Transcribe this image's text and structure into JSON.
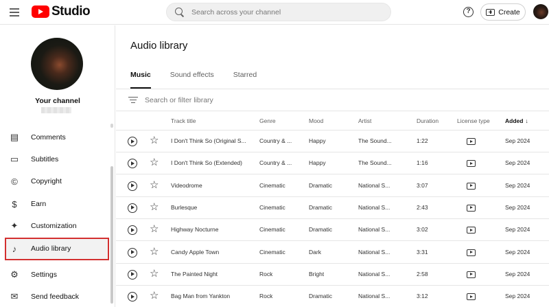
{
  "header": {
    "logo_text": "Studio",
    "search_placeholder": "Search across your channel",
    "help_symbol": "?",
    "create_label": "Create"
  },
  "sidebar": {
    "channel_title": "Your channel",
    "items": [
      {
        "label": "Comments",
        "icon": "comment-icon",
        "glyph": "▤"
      },
      {
        "label": "Subtitles",
        "icon": "subtitles-icon",
        "glyph": "▭"
      },
      {
        "label": "Copyright",
        "icon": "copyright-icon",
        "glyph": "©"
      },
      {
        "label": "Earn",
        "icon": "dollar-icon",
        "glyph": "$"
      },
      {
        "label": "Customization",
        "icon": "magic-wand-icon",
        "glyph": "✦"
      },
      {
        "label": "Audio library",
        "icon": "audio-library-icon",
        "glyph": "♪",
        "active": true
      },
      {
        "label": "Settings",
        "icon": "gear-icon",
        "glyph": "⚙"
      },
      {
        "label": "Send feedback",
        "icon": "feedback-icon",
        "glyph": "✉"
      }
    ]
  },
  "main": {
    "title": "Audio library",
    "tabs": [
      {
        "label": "Music",
        "active": true
      },
      {
        "label": "Sound effects"
      },
      {
        "label": "Starred"
      }
    ],
    "filter_placeholder": "Search or filter library",
    "columns": {
      "track_title": "Track title",
      "genre": "Genre",
      "mood": "Mood",
      "artist": "Artist",
      "duration": "Duration",
      "license_type": "License type",
      "added": "Added",
      "added_sort_arrow": "↓"
    },
    "rows": [
      {
        "title": "I Don't Think So (Original S...",
        "genre": "Country & ...",
        "mood": "Happy",
        "artist": "The Sound...",
        "duration": "1:22",
        "added": "Sep 2024"
      },
      {
        "title": "I Don't Think So (Extended)",
        "genre": "Country & ...",
        "mood": "Happy",
        "artist": "The Sound...",
        "duration": "1:16",
        "added": "Sep 2024"
      },
      {
        "title": "Videodrome",
        "genre": "Cinematic",
        "mood": "Dramatic",
        "artist": "National S...",
        "duration": "3:07",
        "added": "Sep 2024"
      },
      {
        "title": "Burlesque",
        "genre": "Cinematic",
        "mood": "Dramatic",
        "artist": "National S...",
        "duration": "2:43",
        "added": "Sep 2024"
      },
      {
        "title": "Highway Nocturne",
        "genre": "Cinematic",
        "mood": "Dramatic",
        "artist": "National S...",
        "duration": "3:02",
        "added": "Sep 2024"
      },
      {
        "title": "Candy Apple Town",
        "genre": "Cinematic",
        "mood": "Dark",
        "artist": "National S...",
        "duration": "3:31",
        "added": "Sep 2024"
      },
      {
        "title": "The Painted Night",
        "genre": "Rock",
        "mood": "Bright",
        "artist": "National S...",
        "duration": "2:58",
        "added": "Sep 2024"
      },
      {
        "title": "Bag Man from Yankton",
        "genre": "Rock",
        "mood": "Dramatic",
        "artist": "National S...",
        "duration": "3:12",
        "added": "Sep 2024"
      }
    ]
  },
  "colors": {
    "brand_red": "#ff0000",
    "active_outline": "#d32f2f"
  }
}
